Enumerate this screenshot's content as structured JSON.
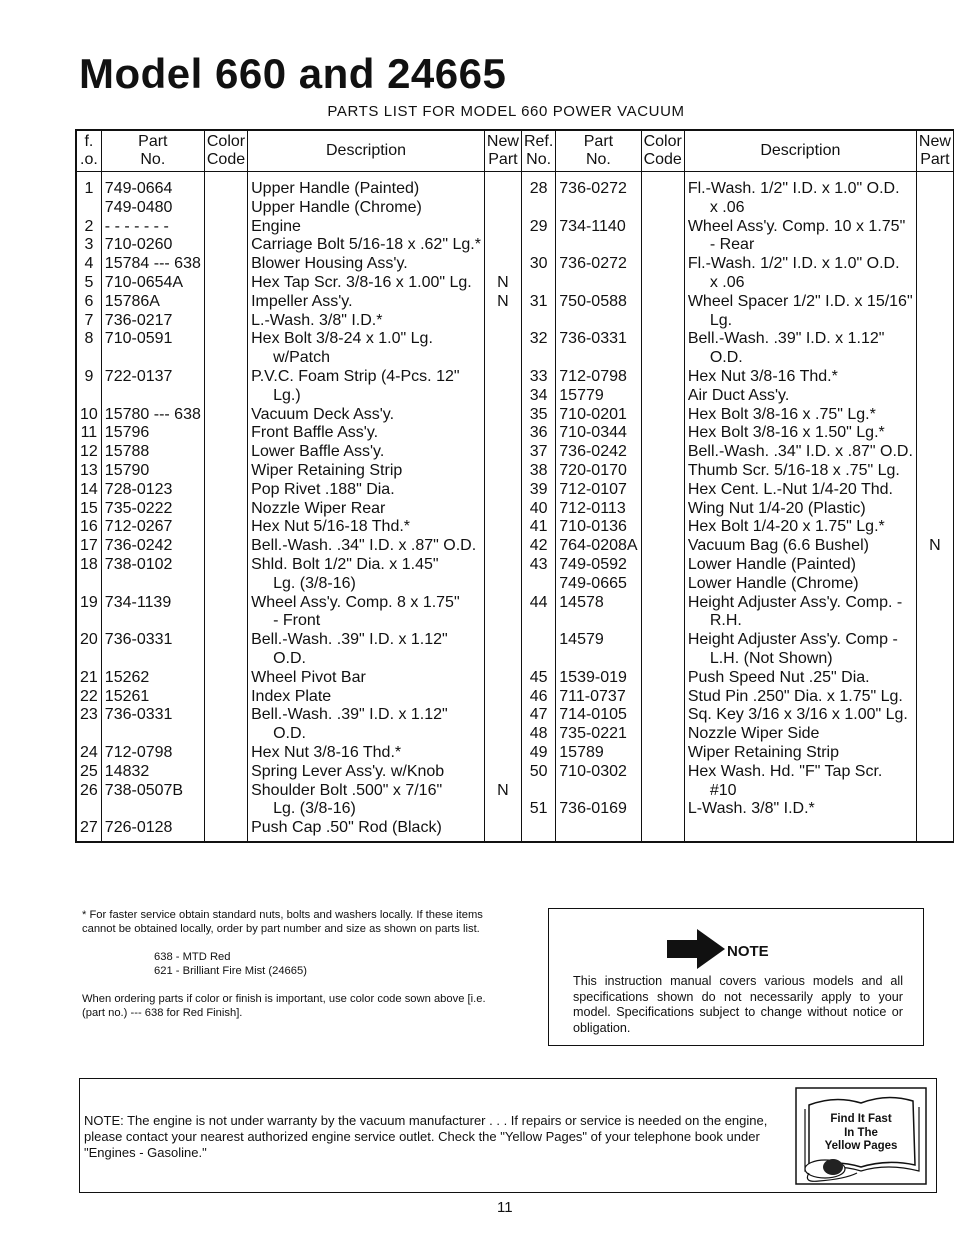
{
  "page": {
    "title": "Model 660 and 24665",
    "subtitle": "PARTS LIST FOR MODEL 660 POWER VACUUM",
    "page_number": "11"
  },
  "table": {
    "headers": {
      "ref_a": "Ref. No.",
      "ref_a_line1": "f.",
      "ref_a_line2": ".o.",
      "part_line1": "Part",
      "part_line2": "No.",
      "color_line1": "Color",
      "color_line2": "Code",
      "description": "Description",
      "new_line1": "New",
      "new_line2": "Part",
      "ref_line1": "Ref.",
      "ref_line2": "No."
    },
    "left": [
      {
        "ref": "1",
        "part": "749-0664",
        "desc": "Upper Handle (Painted)",
        "cont": "",
        "new": ""
      },
      {
        "ref": "",
        "part": "749-0480",
        "desc": "Upper Handle (Chrome)",
        "cont": "",
        "new": ""
      },
      {
        "ref": "2",
        "part": "- - - - - - -",
        "desc": "Engine",
        "cont": "",
        "new": ""
      },
      {
        "ref": "3",
        "part": "710-0260",
        "desc": "Carriage Bolt 5/16-18 x .62\" Lg.*",
        "cont": "",
        "new": ""
      },
      {
        "ref": "4",
        "part": "15784 --- 638",
        "desc": "Blower Housing Ass'y.",
        "cont": "",
        "new": ""
      },
      {
        "ref": "5",
        "part": "710-0654A",
        "desc": "Hex Tap Scr. 3/8-16 x 1.00\" Lg.",
        "cont": "",
        "new": "N"
      },
      {
        "ref": "6",
        "part": "15786A",
        "desc": "Impeller Ass'y.",
        "cont": "",
        "new": "N"
      },
      {
        "ref": "7",
        "part": "736-0217",
        "desc": "L.-Wash. 3/8\" I.D.*",
        "cont": "",
        "new": ""
      },
      {
        "ref": "8",
        "part": "710-0591",
        "desc": "Hex Bolt 3/8-24 x 1.0\" Lg.",
        "cont": "w/Patch",
        "new": ""
      },
      {
        "ref": "9",
        "part": "722-0137",
        "desc": "P.V.C. Foam Strip (4-Pcs. 12\"",
        "cont": "Lg.)",
        "new": ""
      },
      {
        "ref": "10",
        "part": "15780 --- 638",
        "desc": "Vacuum Deck Ass'y.",
        "cont": "",
        "new": ""
      },
      {
        "ref": "11",
        "part": "15796",
        "desc": "Front Baffle Ass'y.",
        "cont": "",
        "new": ""
      },
      {
        "ref": "12",
        "part": "15788",
        "desc": "Lower Baffle Ass'y.",
        "cont": "",
        "new": ""
      },
      {
        "ref": "13",
        "part": "15790",
        "desc": "Wiper Retaining Strip",
        "cont": "",
        "new": ""
      },
      {
        "ref": "14",
        "part": "728-0123",
        "desc": "Pop Rivet .188\" Dia.",
        "cont": "",
        "new": ""
      },
      {
        "ref": "15",
        "part": "735-0222",
        "desc": "Nozzle Wiper Rear",
        "cont": "",
        "new": ""
      },
      {
        "ref": "16",
        "part": "712-0267",
        "desc": "Hex Nut 5/16-18 Thd.*",
        "cont": "",
        "new": ""
      },
      {
        "ref": "17",
        "part": "736-0242",
        "desc": "Bell.-Wash. .34\" I.D. x .87\" O.D.",
        "cont": "",
        "new": ""
      },
      {
        "ref": "18",
        "part": "738-0102",
        "desc": "Shld. Bolt 1/2\" Dia. x 1.45\"",
        "cont": "Lg. (3/8-16)",
        "new": ""
      },
      {
        "ref": "19",
        "part": "734-1139",
        "desc": "Wheel Ass'y. Comp. 8 x 1.75\"",
        "cont": "- Front",
        "new": ""
      },
      {
        "ref": "20",
        "part": "736-0331",
        "desc": "Bell.-Wash. .39\" I.D. x 1.12\"",
        "cont": "O.D.",
        "new": ""
      },
      {
        "ref": "21",
        "part": "15262",
        "desc": "Wheel Pivot Bar",
        "cont": "",
        "new": ""
      },
      {
        "ref": "22",
        "part": "15261",
        "desc": "Index Plate",
        "cont": "",
        "new": ""
      },
      {
        "ref": "23",
        "part": "736-0331",
        "desc": "Bell.-Wash. .39\" I.D. x 1.12\"",
        "cont": "O.D.",
        "new": ""
      },
      {
        "ref": "24",
        "part": "712-0798",
        "desc": "Hex Nut 3/8-16 Thd.*",
        "cont": "",
        "new": ""
      },
      {
        "ref": "25",
        "part": "14832",
        "desc": "Spring Lever Ass'y. w/Knob",
        "cont": "",
        "new": ""
      },
      {
        "ref": "26",
        "part": "738-0507B",
        "desc": "Shoulder Bolt .500\" x 7/16\"",
        "cont": "Lg. (3/8-16)",
        "new": "N"
      },
      {
        "ref": "27",
        "part": "726-0128",
        "desc": "Push Cap .50\" Rod (Black)",
        "cont": "",
        "new": ""
      }
    ],
    "right": [
      {
        "ref": "28",
        "part": "736-0272",
        "desc": "Fl.-Wash. 1/2\" I.D. x 1.0\" O.D.",
        "cont": "x .06",
        "new": ""
      },
      {
        "ref": "29",
        "part": "734-1140",
        "desc": "Wheel Ass'y. Comp. 10 x 1.75\"",
        "cont": "- Rear",
        "new": ""
      },
      {
        "ref": "30",
        "part": "736-0272",
        "desc": "Fl.-Wash. 1/2\" I.D. x 1.0\" O.D.",
        "cont": "x .06",
        "new": ""
      },
      {
        "ref": "31",
        "part": "750-0588",
        "desc": "Wheel Spacer 1/2\" I.D. x 15/16\"",
        "cont": "Lg.",
        "new": ""
      },
      {
        "ref": "32",
        "part": "736-0331",
        "desc": "Bell.-Wash. .39\" I.D. x 1.12\"",
        "cont": "O.D.",
        "new": ""
      },
      {
        "ref": "33",
        "part": "712-0798",
        "desc": "Hex Nut 3/8-16 Thd.*",
        "cont": "",
        "new": ""
      },
      {
        "ref": "34",
        "part": "15779",
        "desc": "Air Duct Ass'y.",
        "cont": "",
        "new": ""
      },
      {
        "ref": "35",
        "part": "710-0201",
        "desc": "Hex Bolt 3/8-16 x .75\" Lg.*",
        "cont": "",
        "new": ""
      },
      {
        "ref": "36",
        "part": "710-0344",
        "desc": "Hex Bolt 3/8-16 x 1.50\" Lg.*",
        "cont": "",
        "new": ""
      },
      {
        "ref": "37",
        "part": "736-0242",
        "desc": "Bell.-Wash. .34\" I.D. x .87\" O.D.",
        "cont": "",
        "new": ""
      },
      {
        "ref": "38",
        "part": "720-0170",
        "desc": "Thumb Scr. 5/16-18 x .75\" Lg.",
        "cont": "",
        "new": ""
      },
      {
        "ref": "39",
        "part": "712-0107",
        "desc": "Hex Cent. L.-Nut 1/4-20 Thd.",
        "cont": "",
        "new": ""
      },
      {
        "ref": "40",
        "part": "712-0113",
        "desc": "Wing Nut 1/4-20 (Plastic)",
        "cont": "",
        "new": ""
      },
      {
        "ref": "41",
        "part": "710-0136",
        "desc": "Hex Bolt 1/4-20 x 1.75\" Lg.*",
        "cont": "",
        "new": ""
      },
      {
        "ref": "42",
        "part": "764-0208A",
        "desc": "Vacuum Bag  (6.6 Bushel)",
        "cont": "",
        "new": "N"
      },
      {
        "ref": "43",
        "part": "749-0592",
        "desc": "Lower Handle (Painted)",
        "cont": "",
        "new": ""
      },
      {
        "ref": "",
        "part": "749-0665",
        "desc": "Lower Handle (Chrome)",
        "cont": "",
        "new": ""
      },
      {
        "ref": "44",
        "part": "14578",
        "desc": "Height Adjuster Ass'y. Comp. -",
        "cont": "R.H.",
        "new": ""
      },
      {
        "ref": "",
        "part": "14579",
        "desc": "Height Adjuster Ass'y. Comp -",
        "cont": "L.H. (Not Shown)",
        "new": ""
      },
      {
        "ref": "45",
        "part": "1539-019",
        "desc": "Push Speed Nut .25\" Dia.",
        "cont": "",
        "new": ""
      },
      {
        "ref": "46",
        "part": "711-0737",
        "desc": "Stud Pin .250\" Dia. x 1.75\" Lg.",
        "cont": "",
        "new": ""
      },
      {
        "ref": "47",
        "part": "714-0105",
        "desc": "Sq. Key 3/16 x 3/16 x 1.00\" Lg.",
        "cont": "",
        "new": ""
      },
      {
        "ref": "48",
        "part": "735-0221",
        "desc": "Nozzle Wiper Side",
        "cont": "",
        "new": ""
      },
      {
        "ref": "49",
        "part": "15789",
        "desc": "Wiper Retaining Strip",
        "cont": "",
        "new": ""
      },
      {
        "ref": "50",
        "part": "710-0302",
        "desc": "Hex Wash. Hd. \"F\" Tap Scr.",
        "cont": "#10",
        "new": ""
      },
      {
        "ref": "51",
        "part": "736-0169",
        "desc": "L-Wash. 3/8\" I.D.*",
        "cont": "",
        "new": ""
      }
    ]
  },
  "footnote": {
    "line1": "* For faster service obtain standard nuts, bolts and washers locally. If these items cannot be obtained locally, order by part number and size as shown on parts list.",
    "codes": [
      "638 - MTD Red",
      "621 - Brilliant Fire Mist (24665)"
    ],
    "ordering": "When ordering parts if color or finish is important, use color code sown above [i.e. (part no.) --- 638 for Red Finish]."
  },
  "note_box": {
    "icon": "arrow-right-icon",
    "heading": "NOTE",
    "body": "This instruction manual covers various models and all specifications shown do not necessarily apply to your model. Specifications subject to change without notice or obligation."
  },
  "engine_note": {
    "text": "NOTE: The engine is not under warranty by the vacuum manufacturer . . . If repairs or service is needed on the engine, please contact your nearest authorized engine service outlet. Check the \"Yellow Pages\" of your telephone book under \"Engines - Gasoline.\"",
    "yellow_pages": {
      "icon": "book-phone-icon",
      "line1": "Find It Fast",
      "line2": "In The",
      "line3": "Yellow Pages"
    }
  }
}
